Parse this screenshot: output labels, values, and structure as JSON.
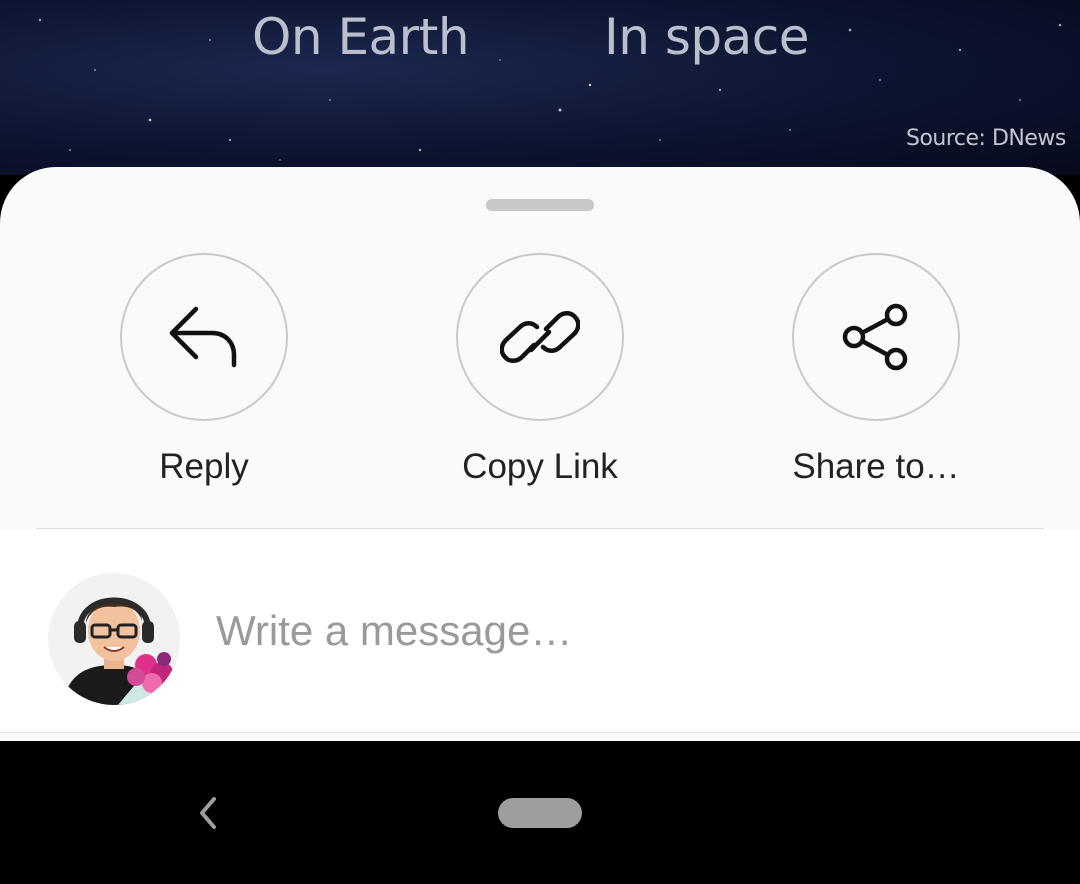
{
  "background_image": {
    "label_left": "On Earth",
    "label_right": "In space",
    "source": "Source: DNews"
  },
  "share_sheet": {
    "actions": [
      {
        "label": "Reply",
        "icon": "reply-arrow-icon"
      },
      {
        "label": "Copy Link",
        "icon": "link-icon"
      },
      {
        "label": "Share to…",
        "icon": "share-icon"
      }
    ],
    "message": {
      "placeholder": "Write a message…",
      "value": "",
      "avatar": "bitmoji-avatar"
    }
  },
  "nav_bar": {
    "back_icon": "chevron-left-icon",
    "home_icon": "home-pill-icon"
  },
  "colors": {
    "sheet_bg": "#fafafa",
    "circle_border": "#c9c9c9",
    "label_text": "#222222",
    "placeholder_text": "#9a9a9a",
    "nav_bg": "#000000"
  }
}
